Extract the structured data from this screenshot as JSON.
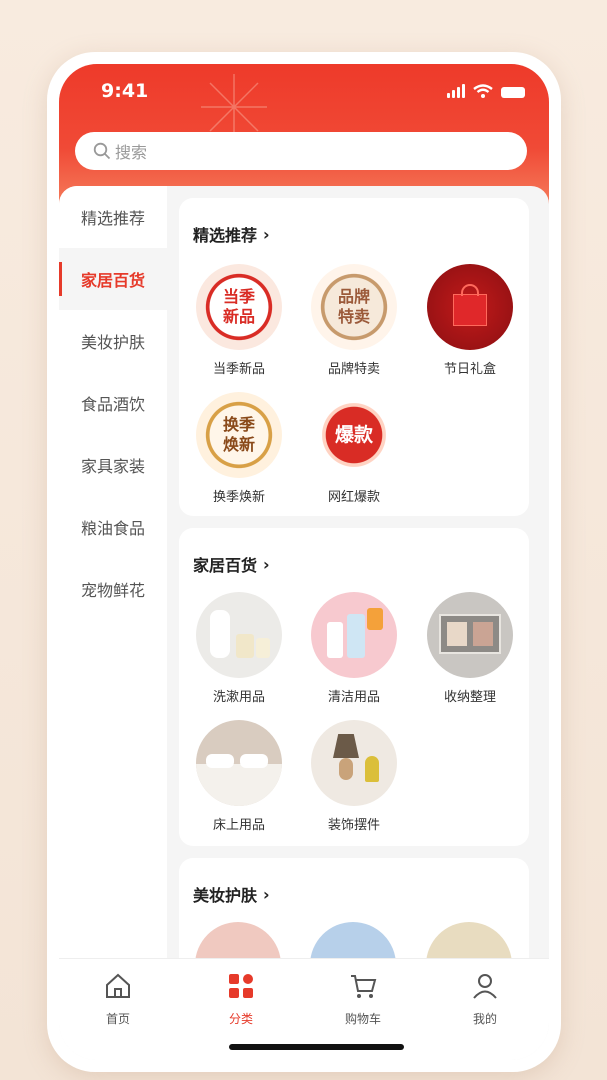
{
  "status": {
    "time": "9:41"
  },
  "search": {
    "placeholder": "搜索"
  },
  "sidebar": {
    "items": [
      {
        "label": "精选推荐"
      },
      {
        "label": "家居百货"
      },
      {
        "label": "美妆护肤"
      },
      {
        "label": "食品酒饮"
      },
      {
        "label": "家具家装"
      },
      {
        "label": "粮油食品"
      },
      {
        "label": "宠物鲜花"
      }
    ],
    "active_index": 1
  },
  "sections": [
    {
      "title": "精选推荐",
      "items": [
        {
          "label": "当季新品",
          "badge": [
            "当季",
            "新品"
          ]
        },
        {
          "label": "品牌特卖",
          "badge": [
            "品牌",
            "特卖"
          ]
        },
        {
          "label": "节日礼盒"
        },
        {
          "label": "换季焕新",
          "badge": [
            "换季",
            "焕新"
          ]
        },
        {
          "label": "网红爆款",
          "badge": [
            "爆款"
          ]
        }
      ]
    },
    {
      "title": "家居百货",
      "items": [
        {
          "label": "洗漱用品"
        },
        {
          "label": "清洁用品"
        },
        {
          "label": "收纳整理"
        },
        {
          "label": "床上用品"
        },
        {
          "label": "装饰摆件"
        }
      ]
    },
    {
      "title": "美妆护肤",
      "items": []
    }
  ],
  "tabbar": {
    "items": [
      {
        "label": "首页",
        "icon": "home-icon"
      },
      {
        "label": "分类",
        "icon": "category-icon"
      },
      {
        "label": "购物车",
        "icon": "cart-icon"
      },
      {
        "label": "我的",
        "icon": "user-icon"
      }
    ],
    "active_index": 1
  },
  "colors": {
    "accent": "#e63a2a",
    "header": "#ee3a2a"
  }
}
